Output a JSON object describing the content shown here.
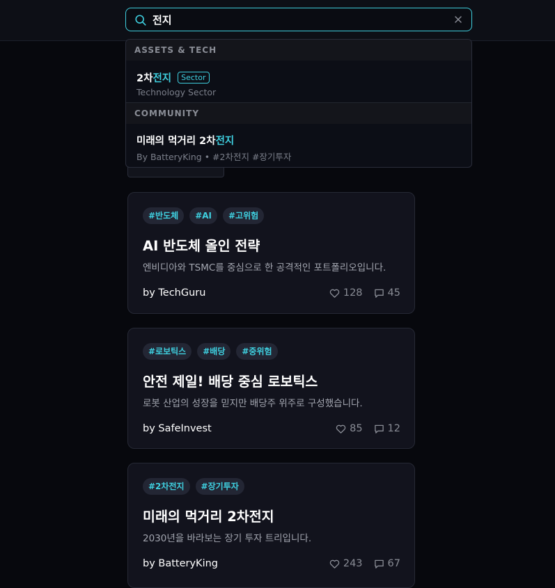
{
  "search": {
    "query": "전지",
    "placeholder": ""
  },
  "dropdown": {
    "sections": [
      {
        "header": "ASSETS & TECH",
        "result": {
          "title_prefix": "2차",
          "title_highlight": "전지",
          "badge": "Sector",
          "subtitle": "Technology Sector"
        }
      },
      {
        "header": "COMMUNITY",
        "result": {
          "title_prefix": "미래의 먹거리 2차",
          "title_highlight": "전지",
          "subtitle": "By BatteryKing • #2차전지 #장기투자"
        }
      }
    ]
  },
  "cards": [
    {
      "tags": [
        "#반도체",
        "#AI",
        "#고위험"
      ],
      "title": "AI 반도체 올인 전략",
      "description": "엔비디아와 TSMC를 중심으로 한 공격적인 포트폴리오입니다.",
      "author": "by TechGuru",
      "likes": "128",
      "comments": "45"
    },
    {
      "tags": [
        "#로보틱스",
        "#배당",
        "#중위험"
      ],
      "title": "안전 제일! 배당 중심 로보틱스",
      "description": "로봇 산업의 성장을 믿지만 배당주 위주로 구성했습니다.",
      "author": "by SafeInvest",
      "likes": "85",
      "comments": "12"
    },
    {
      "tags": [
        "#2차전지",
        "#장기투자"
      ],
      "title": "미래의 먹거리 2차전지",
      "description": "2030년을 바라보는 장기 투자 트리입니다.",
      "author": "by BatteryKing",
      "likes": "243",
      "comments": "67"
    }
  ],
  "icons": {
    "search": "search-icon",
    "clear": "close-icon",
    "like": "heart-icon",
    "comment": "comment-icon"
  },
  "colors": {
    "accent": "#3fd0e0",
    "background": "#07080d",
    "card": "#12131d"
  }
}
